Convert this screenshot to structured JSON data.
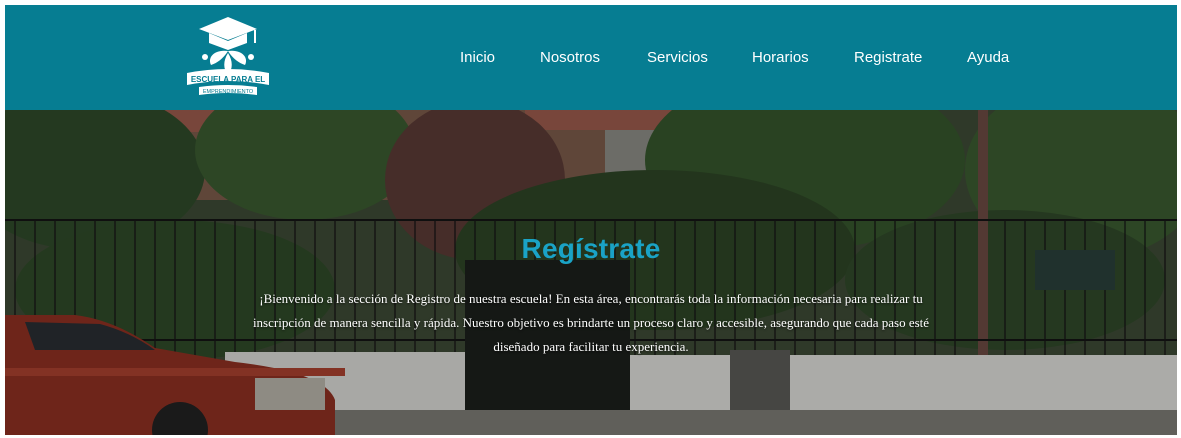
{
  "brand": {
    "logo_line1": "ESCUELA PARA EL",
    "logo_line2": "EMPRENDIMIENTO",
    "header_color": "#067d92"
  },
  "nav": {
    "items": [
      {
        "label": "Inicio"
      },
      {
        "label": "Nosotros"
      },
      {
        "label": "Servicios"
      },
      {
        "label": "Horarios"
      },
      {
        "label": "Registrate"
      },
      {
        "label": "Ayuda"
      }
    ]
  },
  "hero": {
    "title": "Regístrate",
    "title_color": "#1aa3c6",
    "text": "¡Bienvenido a la sección de Registro de nuestra escuela! En esta área, encontrarás toda la información necesaria para realizar tu inscripción de manera sencilla y rápida. Nuestro objetivo es brindarte un proceso claro y accesible, asegurando que cada paso esté diseñado para facilitar tu experiencia."
  }
}
